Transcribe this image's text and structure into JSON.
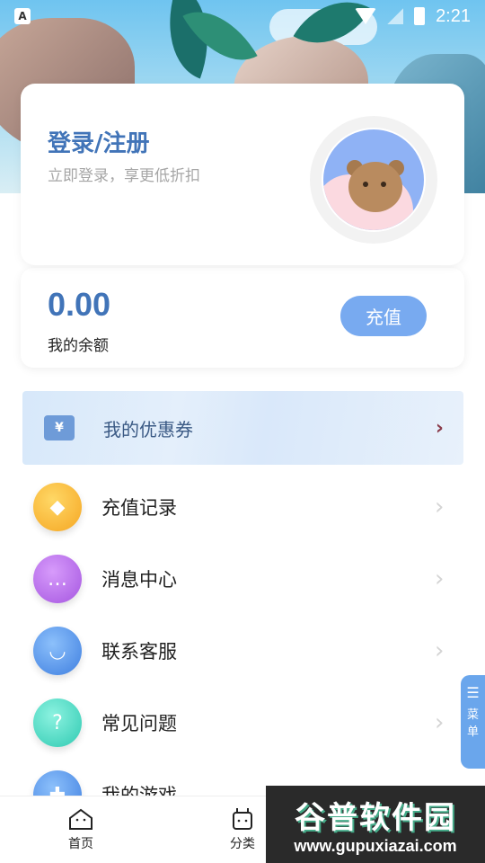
{
  "status_bar": {
    "time": "2:21",
    "app_badge": "A"
  },
  "login": {
    "title": "登录/注册",
    "subtitle": "立即登录，享更低折扣"
  },
  "balance": {
    "value": "0.00",
    "label": "我的余额",
    "recharge_label": "充值"
  },
  "coupon": {
    "icon_text": "¥",
    "label": "我的优惠券",
    "arrow": "›"
  },
  "menu": [
    {
      "label": "充值记录",
      "icon": "money-bag-icon",
      "color": "#f7b52c",
      "glyph": "◆"
    },
    {
      "label": "消息中心",
      "icon": "message-icon",
      "color": "#b36ee8",
      "glyph": "…"
    },
    {
      "label": "联系客服",
      "icon": "headset-icon",
      "color": "#4c8fe6",
      "glyph": "◡"
    },
    {
      "label": "常见问题",
      "icon": "question-icon",
      "color": "#3fd3bd",
      "glyph": "?"
    },
    {
      "label": "我的游戏",
      "icon": "gamepad-icon",
      "color": "#4c8fe6",
      "glyph": "✚"
    }
  ],
  "menu_arrow": "›",
  "side_menu": {
    "line1": "菜",
    "line2": "单"
  },
  "bottom_nav": [
    {
      "label": "首页",
      "icon": "home-icon"
    },
    {
      "label": "分类",
      "icon": "category-icon"
    }
  ],
  "watermark": {
    "title": "谷普软件园",
    "url": "www.gupuxiazai.com"
  }
}
